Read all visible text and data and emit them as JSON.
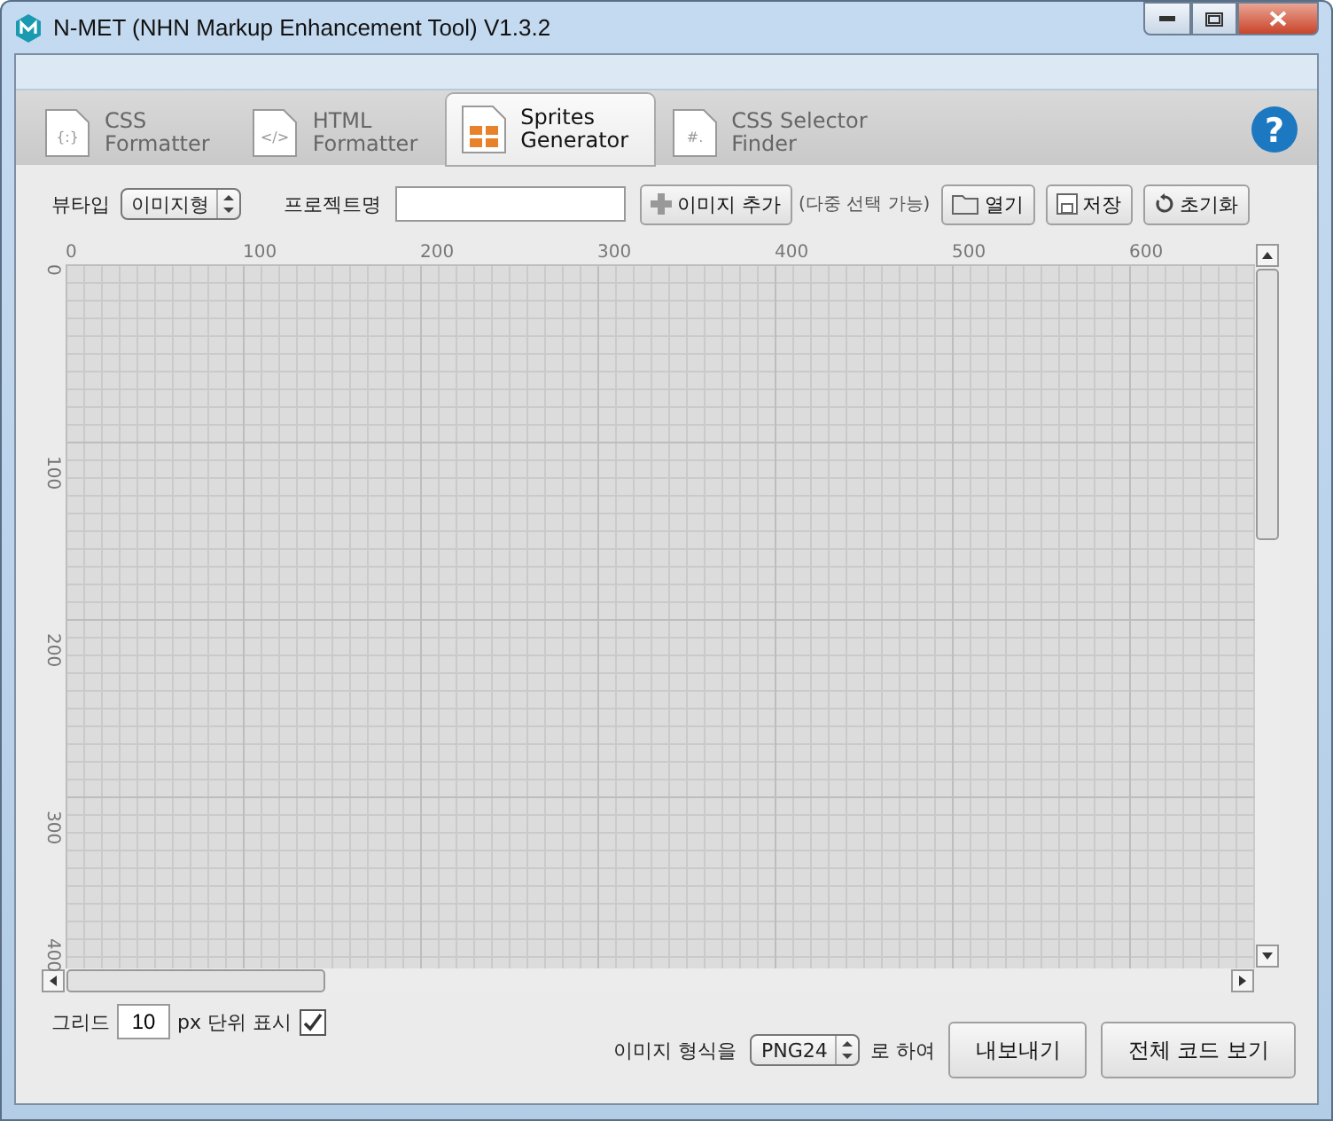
{
  "window": {
    "title": "N-MET (NHN Markup Enhancement Tool) V1.3.2"
  },
  "tabs": [
    {
      "line1": "CSS",
      "line2": "Formatter",
      "kind": "glyph",
      "glyph": "{:}",
      "selected": false
    },
    {
      "line1": "HTML",
      "line2": "Formatter",
      "kind": "glyph",
      "glyph": "</>",
      "selected": false
    },
    {
      "line1": "Sprites",
      "line2": "Generator",
      "kind": "grid",
      "selected": true
    },
    {
      "line1": "CSS Selector",
      "line2": "Finder",
      "kind": "glyph",
      "glyph": "#.",
      "selected": false
    }
  ],
  "help": "?",
  "toolbar": {
    "view_type_label": "뷰타입",
    "view_type_value": "이미지형",
    "project_label": "프로젝트명",
    "add_image": "이미지 추가",
    "add_hint": "(다중 선택 가능)",
    "open": "열기",
    "save": "저장",
    "reset": "초기화"
  },
  "ruler": {
    "top_labels": [
      "0",
      "100",
      "200",
      "300",
      "400",
      "500",
      "600"
    ],
    "left_labels": [
      "0",
      "100",
      "200",
      "300",
      "400"
    ]
  },
  "footer": {
    "grid_label": "그리드",
    "grid_value": "10",
    "grid_unit_label": "px 단위 표시",
    "grid_shown": true,
    "format_label": "이미지 형식을",
    "format_value": "PNG24",
    "format_suffix": "로 하여",
    "export": "내보내기",
    "view_code": "전체 코드 보기"
  }
}
